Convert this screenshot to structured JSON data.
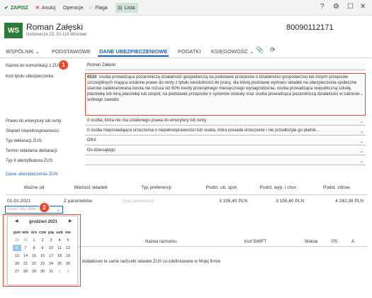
{
  "toolbar": {
    "save": "ZAPISZ",
    "cancel": "Anuluj",
    "operations": "Operacje",
    "flag": "Flaga",
    "list": "Lista",
    "right_icons": [
      "?",
      "⚙",
      "☐",
      "✕"
    ]
  },
  "header": {
    "logo": "WS",
    "name": "Roman Załęski",
    "address": "Noniewicza 23, 52-119 Wrocław",
    "nip": "80090112171"
  },
  "tabs": [
    {
      "label": "WSPÓLNIK ⌄"
    },
    {
      "label": "PODSTAWOWE"
    },
    {
      "label": "DANE UBEZPIECZENIOWE"
    },
    {
      "label": "PODATKI"
    },
    {
      "label": "KSIĘGOWOŚĆ ⌄"
    }
  ],
  "form": {
    "nazwa_label": "Nazwa do komunikacji z ZUS:",
    "nazwa_value": "Roman Załęski",
    "kod_label": "Kod tytułu ubezpieczenia:",
    "kod_code": "0510",
    "kod_text": "osoba prowadząca pozarolniczą działalność gospodarczą na podstawie przepisów o działalności gospodarczej lub innych przepisów szczególnych mająca ustalone prawo do renty z tytułu niezdolności do pracy, dla której podstawę wymiaru składek na ubezpieczenia społeczne stanowi zadeklarowana kwota nie niższa niż 60% kwoty przeciętnego miesięcznego wynagrodzenia, osoba prowadząca niepubliczną szkołę, placówkę lub inną placówkę lub zespół, na podstawie przepisów o systemie oświaty oraz osoba prowadząca pozarolniczą działalność w zakresie wolnego zawodu",
    "renta_label": "Prawo do emerytury lub renty:",
    "renta_value": "0  osoba, która nie ma ustalonego prawa do emerytury lub renty",
    "stopien_label": "Stopień niepełnosprawności:",
    "stopien_value": "0  osoba nieposiadająca orzeczenia o niepełnosprawności lub osoba, która posiada orzeczenie i nie przedłożyła go płatnik...",
    "typ_label": "Typ deklaracji ZUS:",
    "typ_value": "DRA",
    "termin_label": "Termin składania deklaracji:",
    "termin_value": "Do dziesiątego",
    "typ2_label": "Typ II identyfikatora ZUS:",
    "typ2_value": ""
  },
  "zus_section": {
    "title": "Dane ubezpieczenia ZUS",
    "columns": [
      "Ważne od",
      "Wartość składek",
      "Typ preferencji",
      "Podst. ub. społ.",
      "Podst. wyp. i chor.",
      "Podst. zdrow."
    ],
    "row": [
      "01-01-2021",
      "Z parametrów",
      "brak preferencji",
      "3 155,40 PLN",
      "3 155,40 PLN",
      "4 242,38 PLN"
    ],
    "date_placeholder": "Insert day date"
  },
  "bank": {
    "columns": [
      "Nazwa rachunku",
      "Kod SWIFT",
      "Waluta",
      "PS",
      "A"
    ],
    "note": "dodatkowo te same rachunki składek ZUS co zdefiniowane w Mojej firmie"
  },
  "calendar": {
    "month": "grudzień 2021",
    "dow": [
      "pon",
      "wto",
      "śro",
      "czw",
      "pią",
      "sob",
      "nie"
    ],
    "days": [
      "29",
      "30",
      "1",
      "2",
      "3",
      "4",
      "5",
      "6",
      "7",
      "8",
      "9",
      "10",
      "11",
      "12",
      "13",
      "14",
      "15",
      "16",
      "17",
      "18",
      "19",
      "20",
      "21",
      "22",
      "23",
      "24",
      "25",
      "26",
      "27",
      "28",
      "29",
      "30",
      "31",
      "1",
      "2"
    ]
  },
  "callouts": [
    "1",
    "2"
  ],
  "colors": {
    "accent": "#1a62b8",
    "brand": "#2d7d3a",
    "callout": "#e8462e"
  }
}
